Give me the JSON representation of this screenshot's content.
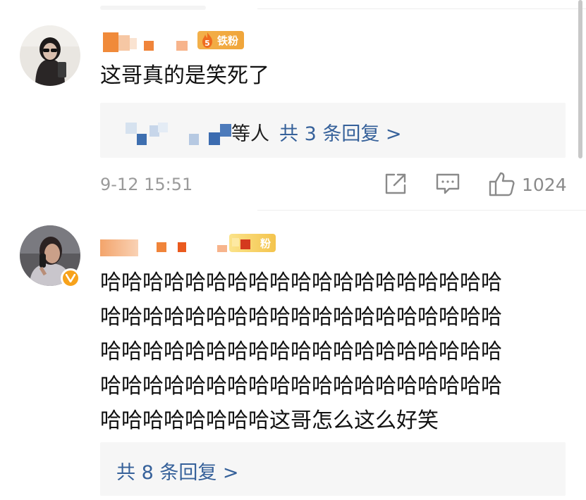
{
  "comments": [
    {
      "fan_badge": {
        "level": "5",
        "label": "铁粉"
      },
      "text": "这哥真的是笑死了",
      "reply_prefix": "等人",
      "reply_link": "共 3 条回复 >",
      "time": "9-12 15:51",
      "likes": "1024"
    },
    {
      "fan_badge": {
        "label": "粉"
      },
      "text_lines": [
        "哈哈哈哈哈哈哈哈哈哈哈哈哈哈哈哈哈哈哈",
        "哈哈哈哈哈哈哈哈哈哈哈哈哈哈哈哈哈哈哈",
        "哈哈哈哈哈哈哈哈哈哈哈哈哈哈哈哈哈哈哈",
        "哈哈哈哈哈哈哈哈哈哈哈哈哈哈哈哈哈哈哈",
        "哈哈哈哈哈哈哈哈这哥怎么这么好笑"
      ],
      "reply_link": "共 8 条回复 >"
    }
  ],
  "colors": {
    "link": "#36619a",
    "meta": "#9a9a9a",
    "reply_bg": "#f6f6f6",
    "badge_orange": "#f0a53a",
    "verified": "#f7a21b"
  },
  "icons": [
    "share-icon",
    "comment-icon",
    "thumbs-up-icon",
    "verified-v-icon",
    "flame-icon"
  ]
}
